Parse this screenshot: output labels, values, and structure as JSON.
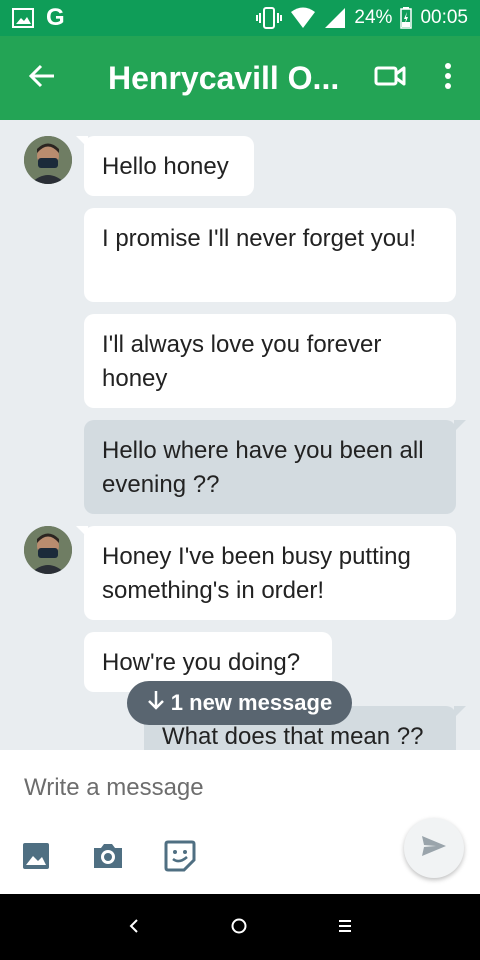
{
  "status_bar": {
    "battery": "24%",
    "time": "00:05"
  },
  "app_bar": {
    "title": "Henrycavill O..."
  },
  "messages": [
    {
      "text": "Hello honey",
      "direction": "incoming"
    },
    {
      "text": "I promise I'll never forget you!",
      "direction": "incoming"
    },
    {
      "text": "I'll always love you forever honey",
      "direction": "incoming"
    },
    {
      "text": "Hello where have you been all evening ??",
      "direction": "outgoing"
    },
    {
      "text": "Honey I've been busy putting something's in order!",
      "direction": "incoming"
    },
    {
      "text": "How're you doing?",
      "direction": "incoming"
    },
    {
      "text": "What does that mean ??",
      "direction": "outgoing"
    }
  ],
  "new_message_pill": "1 new message",
  "composer": {
    "placeholder": "Write a message"
  },
  "icons": {
    "status_left": [
      "gallery-icon",
      "google-icon"
    ],
    "status_right": [
      "vibrate-icon",
      "wifi-icon",
      "signal-icon",
      "battery-icon"
    ],
    "app_bar": [
      "back-arrow-icon",
      "video-call-icon",
      "more-vert-icon"
    ],
    "composer": [
      "image-icon",
      "camera-icon",
      "sticker-icon",
      "send-icon"
    ],
    "nav": [
      "back-icon",
      "home-icon",
      "recents-icon"
    ]
  },
  "colors": {
    "status_bar": "#0f9d58",
    "app_bar": "#23a455",
    "chat_background": "#e9edf0",
    "incoming_bubble": "#ffffff",
    "outgoing_bubble": "#d3dbe0",
    "pill": "#596570",
    "icon_accent": "#4f6f82"
  }
}
